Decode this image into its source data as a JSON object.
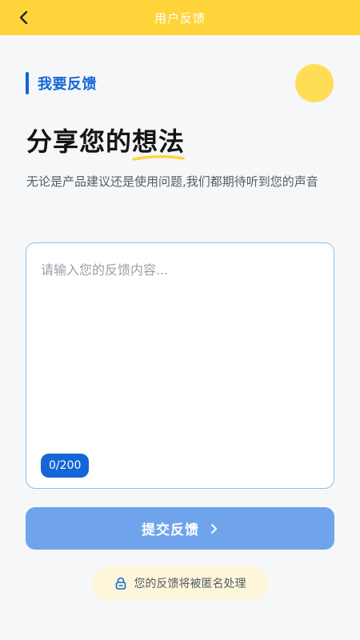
{
  "header": {
    "title": "用户反馈",
    "back_icon": "chevron-left-icon"
  },
  "section": {
    "label": "我要反馈"
  },
  "headline": {
    "part1": "分享您的",
    "highlight": "想法"
  },
  "subtitle": "无论是产品建议还是使用问题,我们都期待听到您的声音",
  "feedback": {
    "placeholder": "请输入您的反馈内容...",
    "value": "",
    "counter": "0/200"
  },
  "submit": {
    "label": "提交反馈",
    "icon": "chevron-right-icon"
  },
  "notice": {
    "icon": "lock-icon",
    "text": "您的反馈将被匿名处理"
  },
  "colors": {
    "header_bg": "#ffd43b",
    "accent": "#1366d6",
    "button_bg": "#6fa4ec",
    "notice_bg": "#fdf6db",
    "deco_circle": "#ffdd55"
  }
}
